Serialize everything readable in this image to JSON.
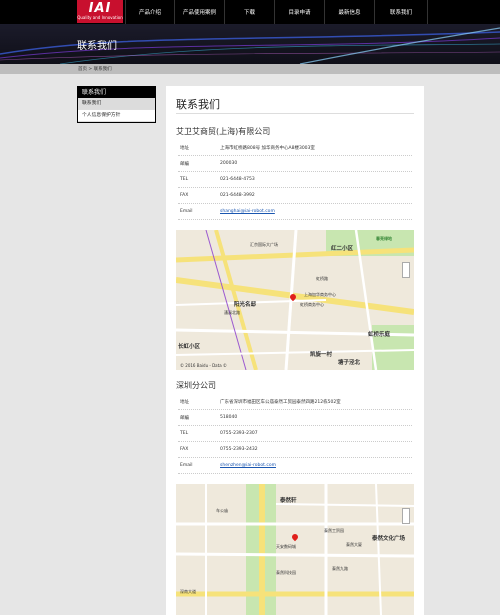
{
  "logo": {
    "text": "IAI",
    "tagline": "Quality and Innovation"
  },
  "nav": [
    {
      "label": ""
    },
    {
      "label": "产品介绍"
    },
    {
      "label": "产品使用案例"
    },
    {
      "label": "下载"
    },
    {
      "label": "目录申请"
    },
    {
      "label": "最新信息"
    },
    {
      "label": "联系我们"
    }
  ],
  "banner": {
    "title": "联系我们"
  },
  "breadcrumb": {
    "text": "首页 > 联系我们"
  },
  "sidebar": {
    "heading": "联系我们",
    "items": [
      {
        "label": "联系我们"
      },
      {
        "label": "个人信息保护方针"
      }
    ]
  },
  "main": {
    "title": "联系我们",
    "offices": [
      {
        "name": "艾卫艾商贸(上海)有限公司",
        "rows": [
          {
            "label": "地址",
            "value": "上海市虹桥路808号 加华商务中心A8楼3003室"
          },
          {
            "label": "邮编",
            "value": "200030"
          },
          {
            "label": "TEL",
            "value": "021-6448-4753"
          },
          {
            "label": "FAX",
            "value": "021-6448-3992"
          },
          {
            "label": "Email",
            "value": "shanghai@iai-robot.com"
          }
        ],
        "map": {
          "labels": [
            "红二小区",
            "春亮绿地",
            "汇京国际大广场",
            "虹桥路",
            "漕溪北路",
            "上海加华商务中心",
            "虹桥商务中心",
            "阳光名邸",
            "凯旋一村",
            "虹桥乐庭",
            "长虹小区",
            "塘子泾北"
          ],
          "copyright": "© 2016 Baidu - Data ©"
        }
      },
      {
        "name": "深圳分公司",
        "rows": [
          {
            "label": "地址",
            "value": "广东省深圳市福田区车公庙泰然工贸园泰然四路212栋502室"
          },
          {
            "label": "邮编",
            "value": "518040"
          },
          {
            "label": "TEL",
            "value": "0755-2393-2307"
          },
          {
            "label": "FAX",
            "value": "0755-2393-2432"
          },
          {
            "label": "Email",
            "value": "shenzhen@iai-robot.com"
          }
        ],
        "map": {
          "labels": [
            "泰然轩",
            "泰然文化广场",
            "车公庙",
            "泰然大厦",
            "泰然工贸园",
            "深南大道",
            "泰然九路",
            "天安数码城",
            "泰然科技园"
          ]
        }
      }
    ]
  },
  "colors": {
    "brand": "#c8102e",
    "link": "#1a56b0"
  }
}
